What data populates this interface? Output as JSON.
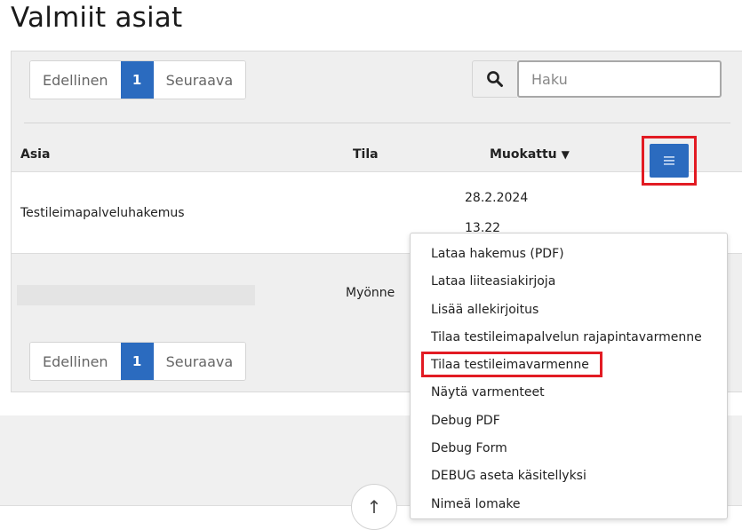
{
  "page": {
    "title": "Valmiit asiat"
  },
  "pagination": {
    "prev_label": "Edellinen",
    "current_page": "1",
    "next_label": "Seuraava"
  },
  "search": {
    "placeholder": "Haku",
    "icon": "search-icon"
  },
  "table": {
    "headers": {
      "asia": "Asia",
      "tila": "Tila",
      "muokattu": "Muokattu"
    },
    "sort_indicator": "▼",
    "rows": [
      {
        "asia": "Testileimapalveluhakemus",
        "tila": "",
        "date": "28.2.2024",
        "time": "13.22"
      },
      {
        "asia": "",
        "tila": "Myönne"
      }
    ]
  },
  "row_menu": {
    "button_icon": "menu-icon",
    "items": [
      "Lataa hakemus (PDF)",
      "Lataa liiteasiakirjoja",
      "Lisää allekirjoitus",
      "Tilaa testileimapalvelun rajapintavarmenne",
      "Tilaa testileimavarmenne",
      "Näytä varmenteet",
      "Debug PDF",
      "Debug Form",
      "DEBUG aseta käsitellyksi",
      "Nimeä lomake"
    ]
  },
  "scroll_top": {
    "icon": "arrow-up-icon",
    "glyph": "↑"
  },
  "colors": {
    "accent": "#2b6bbf",
    "highlight_border": "#e21b23",
    "panel_bg": "#efefef"
  }
}
